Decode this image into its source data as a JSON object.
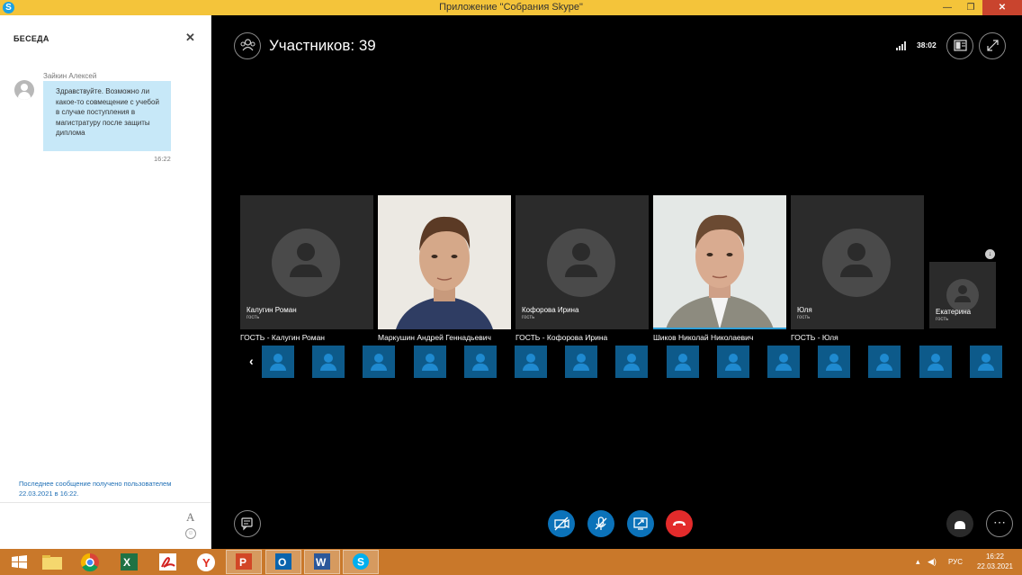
{
  "window": {
    "title": "Приложение \"Собрания Skype\"",
    "minimize": "—",
    "maximize": "❐",
    "close": "✕"
  },
  "conversation": {
    "header": "БЕСЕДА",
    "close": "✕",
    "message": {
      "sender": "Зайкин Алексей",
      "text": "Здравствуйте. Возможно ли какое-то совмещение с учебой в случае поступления в магистратуру после защиты диплома",
      "time": "16:22"
    },
    "last_message_note": "Последнее сообщение получено пользователем 22.03.2021 в 16:22.",
    "compose": {
      "font_label": "A",
      "emoji": "☺"
    }
  },
  "meeting": {
    "participants_label": "Участников: 39",
    "timer": "38:02",
    "tiles": [
      {
        "name": "Калугин Роман",
        "role": "гость",
        "caption": "ГОСТЬ - Калугин Роман",
        "kind": "placeholder"
      },
      {
        "name": "",
        "role": "",
        "caption": "Маркушин Андрей Геннадьевич",
        "kind": "photo"
      },
      {
        "name": "Кофорова Ирина",
        "role": "гость",
        "caption": "ГОСТЬ - Кофорова Ирина",
        "kind": "placeholder"
      },
      {
        "name": "",
        "role": "",
        "caption": "Шиков Николай Николаевич",
        "kind": "photo"
      },
      {
        "name": "Юля",
        "role": "гость",
        "caption": "ГОСТЬ - Юля",
        "kind": "placeholder"
      }
    ],
    "small_tile": {
      "name": "Екатерина",
      "role": "гость"
    },
    "pin_badge": "↓",
    "roster_prev": "‹",
    "roster_count": 15
  },
  "controls": {
    "chat": "chat-icon",
    "camera": "camera-off-icon",
    "mic": "mic-off-icon",
    "share": "share-screen-icon",
    "hangup": "hang-up-icon",
    "call_controls": "phone-icon",
    "more": "⋯"
  },
  "taskbar": {
    "apps": [
      "start",
      "explorer",
      "chrome",
      "excel",
      "acrobat",
      "yandex",
      "powerpoint",
      "outlook",
      "word",
      "skype"
    ],
    "language": "РУС",
    "time": "16:22",
    "date": "22.03.2021"
  },
  "colors": {
    "titlebar": "#f4c43a",
    "taskbar": "#c9782a",
    "bubble": "#c7e8f8",
    "control_blue": "#0b72b9",
    "hangup_red": "#e32b2b"
  }
}
